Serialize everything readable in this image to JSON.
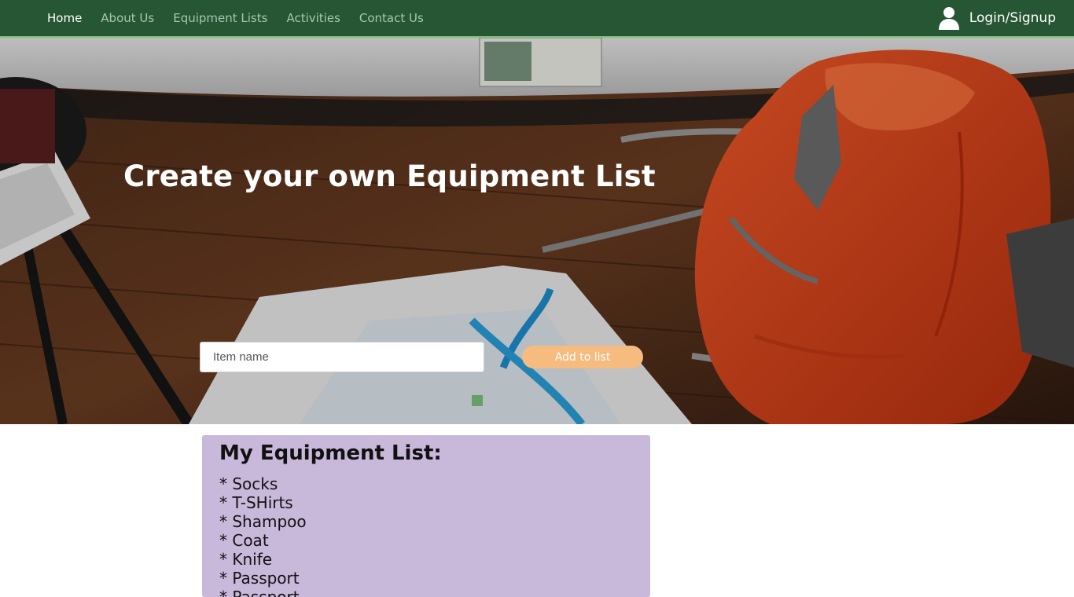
{
  "nav": {
    "items": [
      {
        "label": "Home",
        "active": true
      },
      {
        "label": "About Us",
        "active": false
      },
      {
        "label": "Equipment Lists",
        "active": false
      },
      {
        "label": "Activities",
        "active": false
      },
      {
        "label": "Contact Us",
        "active": false
      }
    ],
    "login_label": "Login/Signup",
    "login_icon": "user-icon"
  },
  "hero": {
    "title": "Create your own Equipment List",
    "input_placeholder": "Item name",
    "add_button_label": "Add to list"
  },
  "list": {
    "title": "My Equipment List:",
    "items": [
      "* Socks",
      "* T-SHirts",
      "* Shampoo",
      "* Coat",
      "* Knife",
      "* Passport",
      "* Passport"
    ]
  },
  "colors": {
    "nav_bg": "#265634",
    "nav_border": "#7fbf7f",
    "button_bg": "#f6bb7e",
    "list_bg": "#c8b8da"
  }
}
